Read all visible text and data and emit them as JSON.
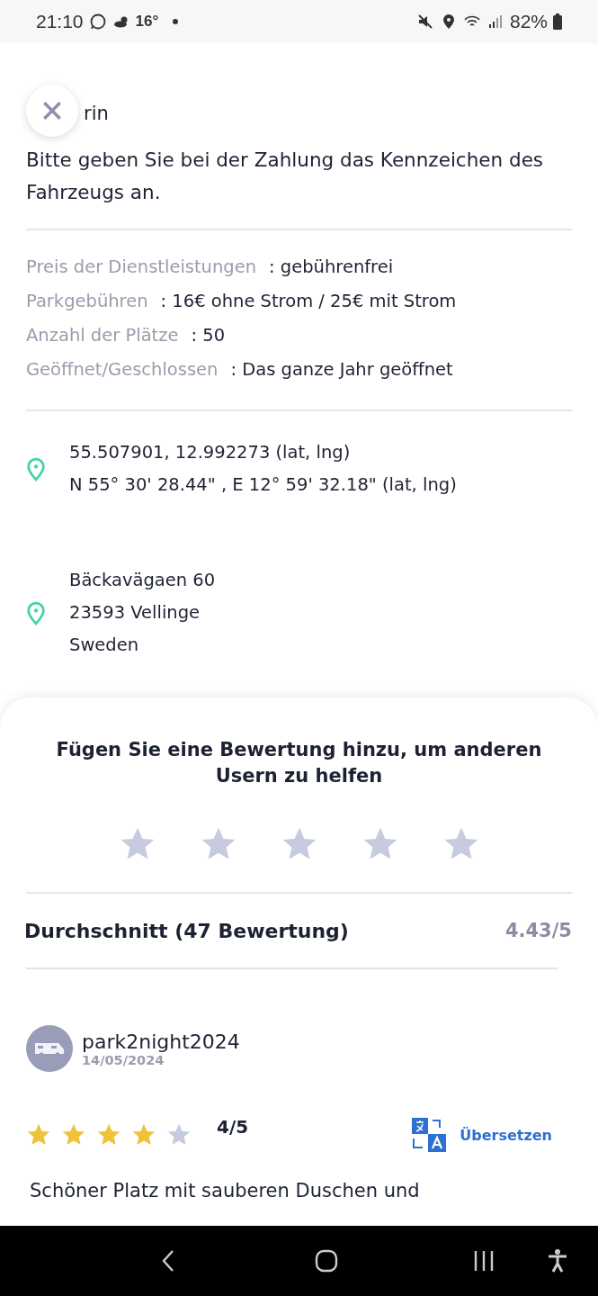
{
  "status_bar": {
    "time": "21:10",
    "temperature": "16°",
    "battery": "82%"
  },
  "header": {
    "title_fragment": "rin"
  },
  "notice": "Bitte geben Sie bei der Zahlung das Kennzeichen des Fahrzeugs an.",
  "info": [
    {
      "label": "Preis der Dienstleistungen",
      "value": ": gebührenfrei"
    },
    {
      "label": "Parkgebühren",
      "value": ": 16€ ohne Strom / 25€ mit Strom"
    },
    {
      "label": "Anzahl der Plätze",
      "value": ": 50"
    },
    {
      "label": "Geöffnet/Geschlossen",
      "value": ": Das ganze Jahr geöffnet"
    }
  ],
  "locations": [
    {
      "lines": [
        "55.507901, 12.992273 (lat, lng)",
        "N 55° 30' 28.44\" , E 12° 59' 32.18\" (lat, lng)"
      ]
    },
    {
      "lines": [
        "Bäckavägaen 60",
        "23593 Vellinge",
        "Sweden"
      ]
    }
  ],
  "rating_sheet": {
    "prompt": "Fügen Sie eine Bewertung hinzu, um anderen Usern zu helfen",
    "average_label": "Durchschnitt (47 Bewertung)",
    "average_value": "4.43/5",
    "review": {
      "user": "park2night2024",
      "date": "14/05/2024",
      "stars": 4,
      "score": "4/5",
      "translate": "Übersetzen",
      "text": "Schöner Platz mit sauberen Duschen und"
    }
  }
}
